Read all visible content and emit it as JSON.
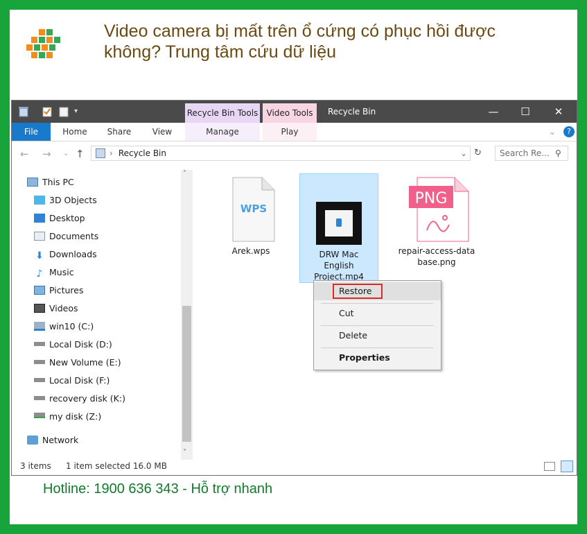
{
  "article": {
    "title": "Video camera bị mất trên ổ cứng có phục hồi được không? Trung tâm cứu dữ liệu",
    "hotline": "Hotline: 1900 636 343 - Hỗ trợ nhanh"
  },
  "colors": {
    "frame": "#17a43a",
    "title": "#6b4a12",
    "hotline": "#127a2a",
    "accent": "#1979ca"
  },
  "window": {
    "title": "Recycle Bin",
    "context_tabs": [
      {
        "label": "Recycle Bin Tools",
        "sub": "Manage"
      },
      {
        "label": "Video Tools",
        "sub": "Play"
      }
    ],
    "controls": {
      "minimize": "—",
      "maximize": "☐",
      "close": "✕"
    }
  },
  "ribbon": {
    "tabs": [
      "File",
      "Home",
      "Share",
      "View"
    ],
    "help": "?"
  },
  "address": {
    "path": "Recycle Bin",
    "search_placeholder": "Search Re..."
  },
  "nav": {
    "items": [
      {
        "label": "This PC",
        "icon": "pc-icon"
      },
      {
        "label": "3D Objects",
        "icon": "3d-objects-icon"
      },
      {
        "label": "Desktop",
        "icon": "desktop-icon"
      },
      {
        "label": "Documents",
        "icon": "documents-icon"
      },
      {
        "label": "Downloads",
        "icon": "downloads-icon"
      },
      {
        "label": "Music",
        "icon": "music-icon"
      },
      {
        "label": "Pictures",
        "icon": "pictures-icon"
      },
      {
        "label": "Videos",
        "icon": "videos-icon"
      },
      {
        "label": "win10 (C:)",
        "icon": "windows-drive-icon"
      },
      {
        "label": "Local Disk (D:)",
        "icon": "drive-icon"
      },
      {
        "label": "New Volume (E:)",
        "icon": "drive-icon"
      },
      {
        "label": "Local Disk (F:)",
        "icon": "drive-icon"
      },
      {
        "label": "recovery disk (K:)",
        "icon": "drive-icon"
      },
      {
        "label": "my disk (Z:)",
        "icon": "network-drive-icon"
      },
      {
        "label": "Network",
        "icon": "network-icon"
      }
    ]
  },
  "files": [
    {
      "name": "Arek.wps",
      "icon_text": "WPS"
    },
    {
      "name": "DRW Mac English Project.mp4",
      "icon_text": ""
    },
    {
      "name": "repair-access-database.png",
      "icon_text": "PNG"
    }
  ],
  "context_menu": {
    "items": [
      "Restore",
      "Cut",
      "Delete",
      "Properties"
    ]
  },
  "status": {
    "count": "3 items",
    "selection": "1 item selected 16.0 MB"
  }
}
